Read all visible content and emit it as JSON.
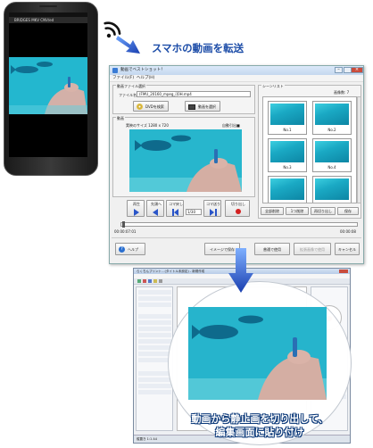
{
  "phone": {
    "app_title": "BRIDGES MKV CNV/ed"
  },
  "transfer": {
    "label": "スマホの動画を転送"
  },
  "window": {
    "title": "動画でベストショット！",
    "menu": [
      "ファイル(F)",
      "ヘルプ(H)"
    ],
    "file_group": {
      "title": "動画ファイル選択",
      "filename_label": "ファイル名",
      "filename_value": "(FMU_20160_mpeg_i]0H.mp4",
      "dvd_button": "DVDを検索",
      "select_button": "動画を選択"
    },
    "video_group": {
      "title": "動画",
      "size_label": "実映のサイズ 1280 x 720",
      "auto_label": "自動引出■"
    },
    "controls": {
      "row1": [
        "再生",
        "先頭へ",
        "コマ戻し",
        "",
        "コマ送り",
        "切り出し"
      ],
      "frame_select": "1/30",
      "timecode_left": "00:00:07:01",
      "timecode_right": "00:00:08"
    },
    "scene_list": {
      "title": "シーンリスト",
      "count_label": "画像数: 7",
      "thumbs": [
        "No.1",
        "No.2",
        "No.3",
        "No.4",
        "",
        ""
      ],
      "buttons": [
        "全部削除",
        "1つ削除",
        "再切り出し",
        "保存"
      ]
    },
    "bottom": {
      "help": "ヘルプ",
      "image_button": "イメージで保存",
      "use_button": "普通で使用",
      "use_zoom_button": "拡張画像で使用",
      "cancel_button": "キャンセル"
    }
  },
  "editor": {
    "title": "らくちんプリント - (タイトル未設定) - 新規作成",
    "status": "縦置き 1:1 A4"
  },
  "caption": {
    "line1": "動画から静止画を切り出して、",
    "line2": "編集画面に貼り付け"
  },
  "colors": {
    "accent": "#1d4da8",
    "water": "#1aa9c4",
    "caption_stroke": "#0d3a7a"
  }
}
